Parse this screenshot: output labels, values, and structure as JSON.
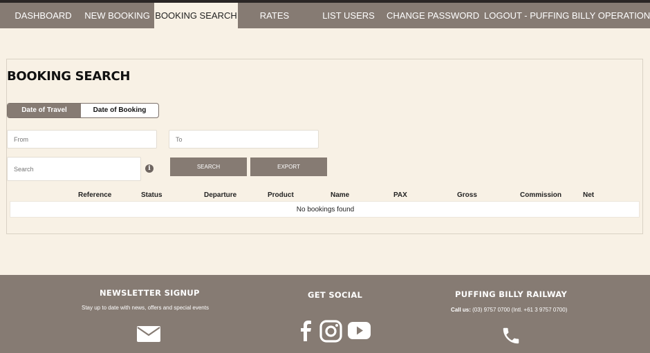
{
  "nav": {
    "dashboard": "DASHBOARD",
    "new_booking": "NEW BOOKING",
    "booking_search": "BOOKING SEARCH",
    "rates": "RATES",
    "list_users": "LIST USERS",
    "change_password": "CHANGE PASSWORD",
    "logout": "LOGOUT - PUFFING BILLY OPERATIONS",
    "active": "BOOKING SEARCH"
  },
  "page": {
    "title": "BOOKING SEARCH"
  },
  "toggle": {
    "date_of_travel": "Date of Travel",
    "date_of_booking": "Date of Booking",
    "selected": "Date of Travel"
  },
  "form": {
    "from_placeholder": "From",
    "to_placeholder": "To",
    "search_placeholder": "Search",
    "search_button": "SEARCH",
    "export_button": "EXPORT"
  },
  "table": {
    "columns": [
      "Reference",
      "Status",
      "Departure",
      "Product",
      "Name",
      "PAX",
      "Gross",
      "Commission",
      "Net"
    ],
    "empty_message": "No bookings found"
  },
  "footer": {
    "newsletter_title": "NEWSLETTER SIGNUP",
    "newsletter_text": "Stay up to date with news, offers and special events",
    "social_title": "GET SOCIAL",
    "railway_title": "PUFFING BILLY RAILWAY",
    "call_label": "Call us:",
    "call_text": "(03) 9757 0700 (Intl. +61 3 9757 0700)"
  },
  "icons": {
    "info": "info-icon",
    "mail": "mail-icon",
    "facebook": "facebook-icon",
    "instagram": "instagram-icon",
    "youtube": "youtube-icon",
    "phone": "phone-icon"
  },
  "colors": {
    "nav_bg": "#867b73",
    "page_bg": "#f8f1e5",
    "button_bg": "#867b73"
  }
}
